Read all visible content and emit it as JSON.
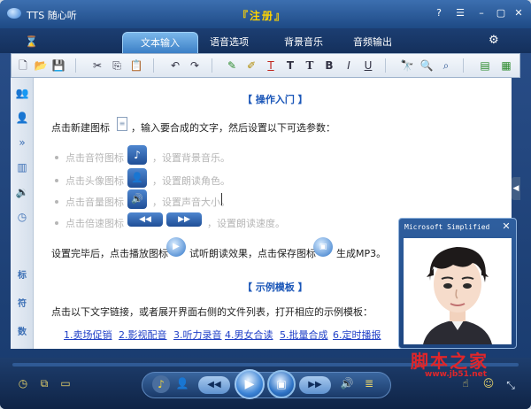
{
  "window": {
    "app_title": "TTS 随心听",
    "register_label": "『注册』"
  },
  "tabs": [
    {
      "label": "文本输入",
      "active": true
    },
    {
      "label": "语音选项",
      "active": false
    },
    {
      "label": "背景音乐",
      "active": false
    },
    {
      "label": "音频输出",
      "active": false
    }
  ],
  "toolbar": {
    "font_label": "T",
    "bold_label": "B",
    "italic_label": "I",
    "underline_label": "U"
  },
  "sidebar": {
    "labels": [
      "标",
      "符",
      "数"
    ]
  },
  "editor": {
    "intro_heading": "【 操作入门 】",
    "intro_line_prefix": "点击新建图标",
    "intro_line_suffix": "，输入要合成的文字，然后设置以下可选参数：",
    "options": [
      {
        "prefix": "点击音符图标",
        "suffix": "，设置背景音乐。"
      },
      {
        "prefix": "点击头像图标",
        "suffix": "，设置朗读角色。"
      },
      {
        "prefix": "点击音量图标",
        "suffix": "，设置声音大小。"
      },
      {
        "prefix": "点击倍速图标",
        "suffix": "，设置朗读速度。"
      }
    ],
    "after_setup": "设置完毕后，点击播放图标",
    "try_listen": "试听朗读效果，点击保存图标",
    "generate_mp3": "生成MP3。",
    "example_heading": "【 示例模板 】",
    "example_instruction": "点击以下文字链接，或者展开界面右侧的文件列表，打开相应的示例模板：",
    "example_links": [
      "1.卖场促销",
      "2.影视配音",
      "3.听力录音",
      "4.男女合读",
      "5.批量合成",
      "6.定时播报"
    ]
  },
  "avatar_panel": {
    "title": "Microsoft Simplified"
  },
  "player": {
    "progress": 0.0
  },
  "watermark": {
    "text": "脚本之家",
    "url": "www.jb51.net"
  },
  "colors": {
    "accent": "#1a56b8",
    "link": "#1f3fc7",
    "window": "#1e4a85",
    "watermark": "#e0262a"
  }
}
